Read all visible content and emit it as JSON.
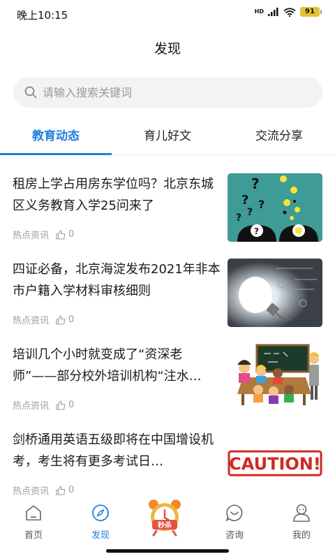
{
  "status_bar": {
    "time": "晚上10:15",
    "network": "HD",
    "battery": "91"
  },
  "page_title": "发现",
  "search": {
    "placeholder": "请输入搜索关键词"
  },
  "tabs": [
    {
      "label": "教育动态",
      "active": true
    },
    {
      "label": "育儿好文",
      "active": false
    },
    {
      "label": "交流分享",
      "active": false
    }
  ],
  "news": [
    {
      "title": "租房上学占用房东学位吗？北京东城区义务教育入学25问来了",
      "tag": "热点资讯",
      "likes": "0",
      "image": "question-marks-lightbulbs"
    },
    {
      "title": "四证必备，北京海淀发布2021年非本市户籍入学材料审核细则",
      "tag": "热点资讯",
      "likes": "0",
      "image": "glowing-lightbulb-chalkboard"
    },
    {
      "title": "培训几个小时就变成了“资深老师”——部分校外培训机构“注水…",
      "tag": "热点资讯",
      "likes": "0",
      "image": "classroom-teacher-students"
    },
    {
      "title": "剑桥通用英语五级即将在中国增设机考，考生将有更多考试日…",
      "tag": "热点资讯",
      "likes": "0",
      "image": "caution-sign"
    }
  ],
  "news_images": {
    "caution_text": "CAUTION!"
  },
  "bottom_nav": [
    {
      "label": "首页",
      "icon": "home-icon",
      "active": false
    },
    {
      "label": "发现",
      "icon": "compass-icon",
      "active": true
    },
    {
      "label": "秒杀",
      "icon": "alarm-clock-icon",
      "active": false
    },
    {
      "label": "咨询",
      "icon": "chat-icon",
      "active": false
    },
    {
      "label": "我的",
      "icon": "user-icon",
      "active": false
    }
  ],
  "colors": {
    "accent": "#1f7fe0",
    "text": "#1a1a1a",
    "muted": "#9b9b9b",
    "search_bg": "#f3f3f3"
  }
}
